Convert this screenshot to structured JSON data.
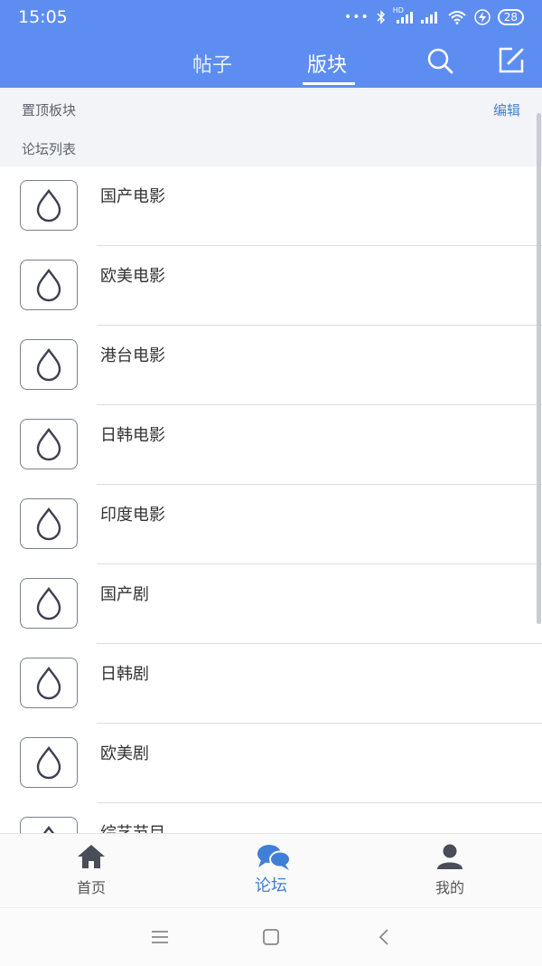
{
  "status_bar": {
    "time": "15:05",
    "signal_dots": "•••",
    "hd_label": "HD",
    "battery": "28"
  },
  "tabs": [
    {
      "label": "帖子",
      "active": false
    },
    {
      "label": "版块",
      "active": true
    }
  ],
  "toolbar_icons": [
    "search-icon",
    "compose-icon"
  ],
  "pinned_section": {
    "label": "置顶板块",
    "edit_label": "编辑"
  },
  "forum_section": {
    "label": "论坛列表"
  },
  "forums": [
    {
      "label": "国产电影"
    },
    {
      "label": "欧美电影"
    },
    {
      "label": "港台电影"
    },
    {
      "label": "日韩电影"
    },
    {
      "label": "印度电影"
    },
    {
      "label": "国产剧"
    },
    {
      "label": "日韩剧"
    },
    {
      "label": "欧美剧"
    },
    {
      "label": "综艺节目"
    }
  ],
  "bottom_nav": [
    {
      "label": "首页",
      "icon": "home-icon",
      "active": false
    },
    {
      "label": "论坛",
      "icon": "forum-icon",
      "active": true
    },
    {
      "label": "我的",
      "icon": "profile-icon",
      "active": false
    }
  ],
  "colors": {
    "header_bg": "#5d8df0",
    "accent": "#3f7fd6",
    "edit_link": "#4a7fce"
  }
}
